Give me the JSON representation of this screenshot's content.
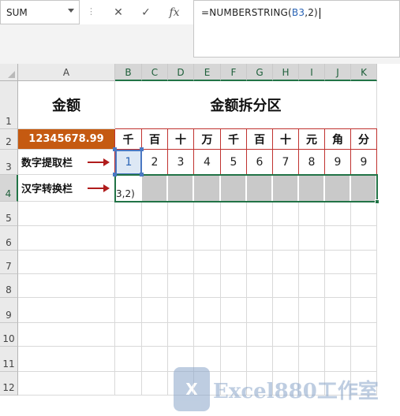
{
  "name_box": {
    "value": "SUM"
  },
  "formula_bar": {
    "buttons": {
      "cancel": "✕",
      "enter": "✓",
      "insert_function": "fx"
    },
    "formula_prefix": "=NUMBERSTRING(",
    "formula_ref": "B3",
    "formula_suffix": ",2)"
  },
  "columns": [
    "A",
    "B",
    "C",
    "D",
    "E",
    "F",
    "G",
    "H",
    "I",
    "J",
    "K"
  ],
  "rows": [
    "1",
    "2",
    "3",
    "4",
    "5",
    "6",
    "7",
    "8",
    "9",
    "10",
    "11",
    "12"
  ],
  "sheet": {
    "a1": "金额",
    "b1": "金额拆分区",
    "a2": "12345678.99",
    "a3": "数字提取栏",
    "a4": "汉字转换栏",
    "units": [
      "千",
      "百",
      "十",
      "万",
      "千",
      "百",
      "十",
      "元",
      "角",
      "分"
    ],
    "digits": [
      "1",
      "2",
      "3",
      "4",
      "5",
      "6",
      "7",
      "8",
      "9",
      "9"
    ],
    "editing_overflow": "3,2)"
  },
  "colors": {
    "accent": "#217346",
    "amount_fill": "#c55a11",
    "border_red": "#c0322f",
    "arrow": "#b01c1c",
    "fill_gray": "#c9c9c9",
    "selection_fill": "#dde8f5"
  },
  "watermark": {
    "logo": "X",
    "text": "Excel880工作室"
  }
}
